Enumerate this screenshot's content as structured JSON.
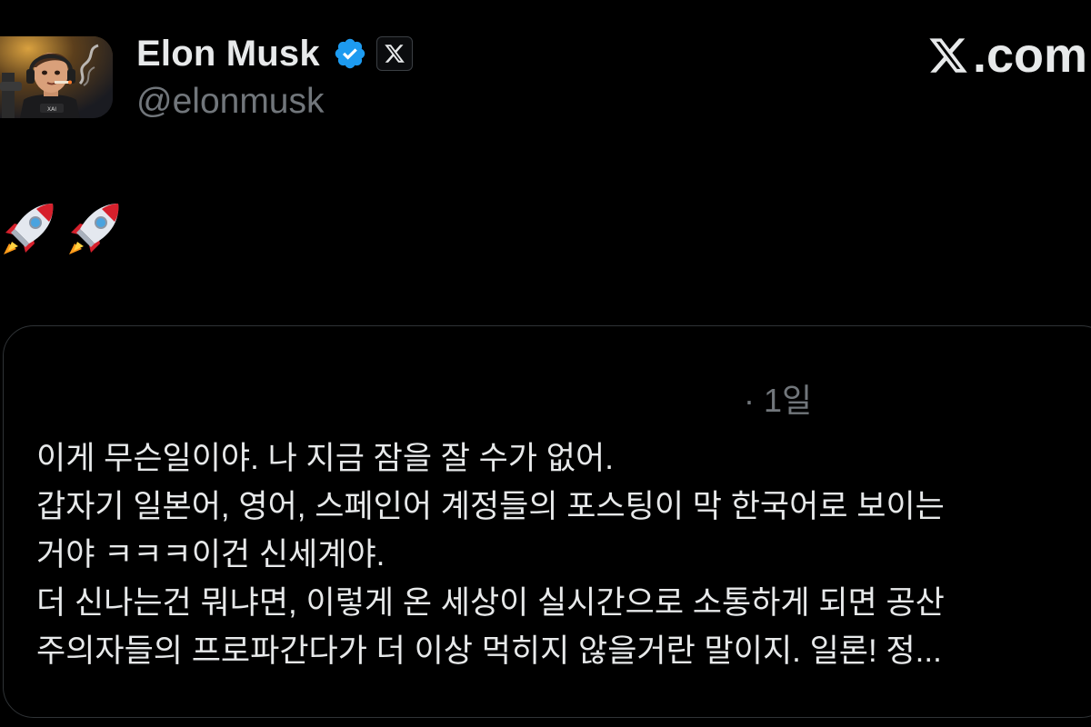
{
  "author": {
    "display_name": "Elon Musk",
    "handle": "@elonmusk",
    "avatar_icon": "avatar-image",
    "verified_icon": "verified-badge-icon",
    "affiliation_icon": "x-logo-icon"
  },
  "brand": {
    "label": ".com",
    "logo_icon": "x-logo-icon"
  },
  "post": {
    "emoji": [
      "🚀",
      "🚀"
    ]
  },
  "quote": {
    "time": "· 1일",
    "lines": [
      "이게 무슨일이야. 나 지금 잠을 잘 수가 없어.",
      "갑자기 일본어, 영어, 스페인어 계정들의 포스팅이 막 한국어로 보이는",
      "거야 ㅋㅋㅋ이건 신세계야.",
      "더 신나는건 뭐냐면, 이렇게 온 세상이 실시간으로 소통하게 되면 공산",
      "주의자들의 프로파간다가 더 이상 먹히지 않을거란 말이지. 일론! 정..."
    ]
  },
  "colors": {
    "background": "#000000",
    "text": "#e7e9ea",
    "secondary": "#71767b",
    "verified": "#1d9bf0",
    "border": "#2f3336"
  }
}
